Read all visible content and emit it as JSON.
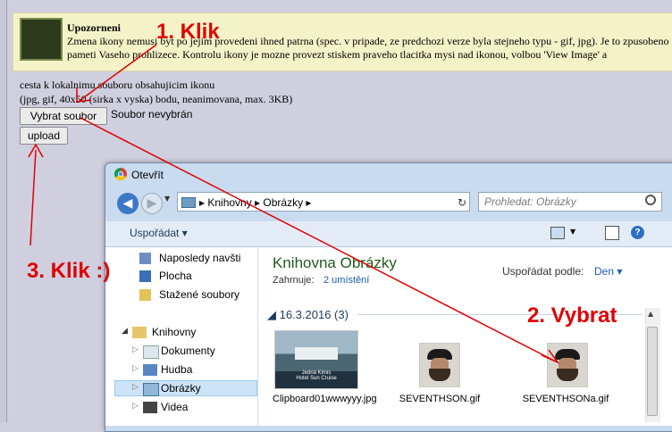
{
  "notice": {
    "title": "Upozorneni",
    "text": "Zmena ikony nemusi byt po jejim provedeni ihned patrna (spec. v pripade, ze predchozi verze byla stejneho typu - gif, jpg). Je to zpusobeno pameti Vaseho prohlizece. Kontrolu ikony je mozne provezt stiskem praveho tlacitka mysi nad ikonou, volbou 'View Image' a"
  },
  "form": {
    "line1": "cesta k lokalnimu souboru obsahujicim ikonu",
    "line2": "(jpg, gif, 40x50 (sirka x vyska) bodu, neanimovana, max. 3KB)",
    "browse_label": "Vybrat soubor",
    "no_file": "Soubor nevybrán",
    "upload_label": "upload"
  },
  "annotations": {
    "step1": "1. Klik",
    "step2": "2. Vybrat",
    "step3": "3. Klik :)"
  },
  "dialog": {
    "title": "Otevřít",
    "address_path": "▸ Knihovny ▸ Obrázky ▸",
    "search_placeholder": "Prohledat: Obrázky",
    "organize": "Uspořádat ▾",
    "nav_items": [
      {
        "label": "Naposledy navšti",
        "icon": "recent-icon"
      },
      {
        "label": "Plocha",
        "icon": "desktop-icon"
      },
      {
        "label": "Stažené soubory",
        "icon": "downloads-icon"
      },
      {
        "label": "Knihovny",
        "icon": "libraries-icon"
      },
      {
        "label": "Dokumenty",
        "icon": "documents-icon"
      },
      {
        "label": "Hudba",
        "icon": "music-icon"
      },
      {
        "label": "Obrázky",
        "icon": "pictures-icon"
      },
      {
        "label": "Videa",
        "icon": "videos-icon"
      }
    ],
    "library_title": "Knihovna Obrázky",
    "includes_label": "Zahrnuje:",
    "includes_link": "2 umístění",
    "arrange_label": "Uspořádat podle:",
    "arrange_value": "Den ▾",
    "group_header": "◢ 16.3.2016 (3)",
    "thumb1_caption": "Jedná Kimis\nHotel Sun Cruise",
    "files": [
      {
        "name": "Clipboard01wwwyyy.jpg"
      },
      {
        "name": "SEVENTHSON.gif"
      },
      {
        "name": "SEVENTHSONa.gif"
      }
    ]
  },
  "colors": {
    "annotation": "#e00000",
    "link": "#1a5cb0",
    "library_title": "#1e5c1e"
  }
}
